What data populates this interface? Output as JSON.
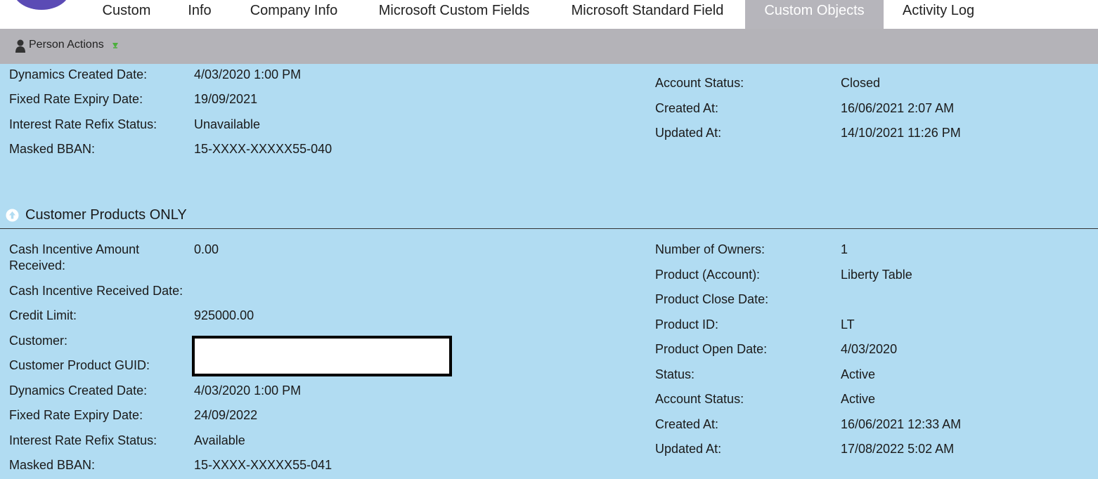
{
  "tabs": [
    {
      "label": "Custom",
      "active": false
    },
    {
      "label": "Info",
      "active": false
    },
    {
      "label": "Company Info",
      "active": false
    },
    {
      "label": "Microsoft Custom Fields",
      "active": false
    },
    {
      "label": "Microsoft Standard Field",
      "active": false
    },
    {
      "label": "Custom Objects",
      "active": true
    },
    {
      "label": "Activity Log",
      "active": false
    }
  ],
  "toolbar": {
    "person_actions": "Person Actions",
    "icon": "person-icon",
    "caret_icon": "caret-down-icon"
  },
  "record1": {
    "left": [
      {
        "label": "Dynamics Created Date:",
        "value": "4/03/2020 1:00 PM"
      },
      {
        "label": "Fixed Rate Expiry Date:",
        "value": "19/09/2021"
      },
      {
        "label": "Interest Rate Refix Status:",
        "value": "Unavailable"
      },
      {
        "label": "Masked BBAN:",
        "value": "15-XXXX-XXXXX55-040"
      }
    ],
    "right": [
      {
        "label": "Account Status:",
        "value": "Closed"
      },
      {
        "label": "Created At:",
        "value": "16/06/2021 2:07 AM"
      },
      {
        "label": "Updated At:",
        "value": "14/10/2021 11:26 PM"
      }
    ]
  },
  "section": {
    "title": "Customer Products ONLY",
    "icon": "collapse-up-icon"
  },
  "record2": {
    "left": [
      {
        "label": "Cash Incentive Amount Received:",
        "value": "0.00"
      },
      {
        "label": "Cash Incentive Received Date:",
        "value": ""
      },
      {
        "label": "Credit Limit:",
        "value": "925000.00"
      },
      {
        "label": "Customer:",
        "value": ""
      },
      {
        "label": "Customer Product GUID:",
        "value": ""
      },
      {
        "label": "Dynamics Created Date:",
        "value": "4/03/2020 1:00 PM"
      },
      {
        "label": "Fixed Rate Expiry Date:",
        "value": "24/09/2022"
      },
      {
        "label": "Interest Rate Refix Status:",
        "value": "Available"
      },
      {
        "label": "Masked BBAN:",
        "value": "15-XXXX-XXXXX55-041"
      }
    ],
    "right": [
      {
        "label": "Number of Owners:",
        "value": "1"
      },
      {
        "label": "Product (Account):",
        "value": "Liberty Table"
      },
      {
        "label": "Product Close Date:",
        "value": ""
      },
      {
        "label": "Product ID:",
        "value": "LT"
      },
      {
        "label": "Product Open Date:",
        "value": "4/03/2020"
      },
      {
        "label": "Status:",
        "value": "Active"
      },
      {
        "label": "Account Status:",
        "value": "Active"
      },
      {
        "label": "Created At:",
        "value": "16/06/2021 12:33 AM"
      },
      {
        "label": "Updated At:",
        "value": "17/08/2022 5:02 AM"
      }
    ]
  }
}
